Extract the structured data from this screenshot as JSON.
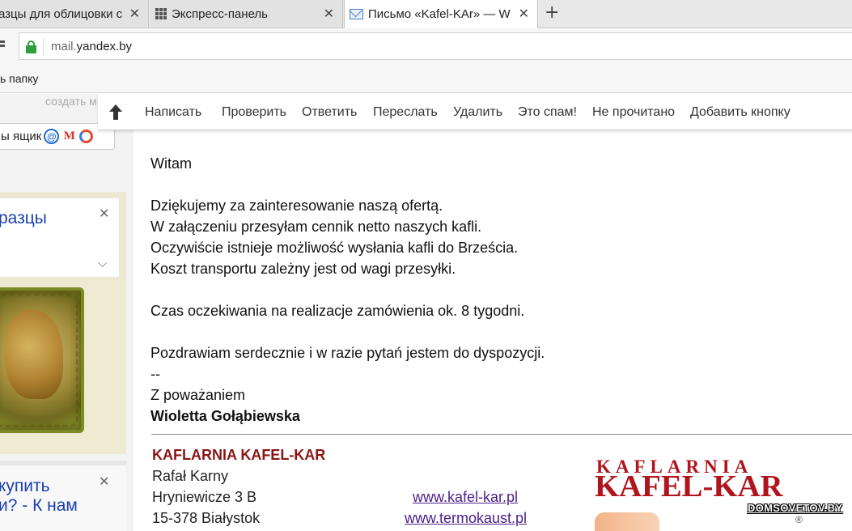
{
  "browser": {
    "tabs": [
      {
        "title": "азцы для облицовки с",
        "close": "✕"
      },
      {
        "title": "Экспресс-панель",
        "close": "✕"
      },
      {
        "title": "Письмо «Kafel-KAr» — Wi",
        "close": "✕"
      }
    ],
    "new_tab": "+",
    "url_prefix": "mail.",
    "url_domain": "yandex.by",
    "bookmark": "ь папку"
  },
  "sidebar": {
    "create_link": "создать м",
    "mailbox_label": "ы ящик",
    "services": {
      "at": "@",
      "gmail": "M",
      "other": ""
    },
    "ad1": {
      "title": "разцы",
      "close": "✕",
      "chevron": "⌵"
    },
    "ad2": {
      "line1": "купить",
      "line2": "и? - К нам",
      "close": "✕"
    }
  },
  "toolbar": {
    "actions": [
      "Написать",
      "Проверить",
      "Ответить",
      "Переслать",
      "Удалить",
      "Это спам!",
      "Не прочитано",
      "Добавить кнопку"
    ]
  },
  "message": {
    "greeting": "Witam",
    "body": [
      "Dziękujemy za zainteresowanie naszą ofertą.",
      "W załączeniu przesyłam cennik netto naszych kafli.",
      "Oczywiście istnieje możliwość wysłania kafli do Brześcia.",
      "Koszt transportu zależny jest od wagi przesyłki."
    ],
    "wait": "Czas oczekiwania na realizacje zamówienia ok. 8 tygodni.",
    "closing": "Pozdrawiam serdecznie i w razie pytań jestem do dyspozycji.",
    "dashes": "--",
    "regards": "Z poważaniem",
    "sender": "Wioletta Gołąbiewska"
  },
  "signature": {
    "company": "KAFLARNIA KAFEL-KAR",
    "person": "Rafał Karny",
    "street": "Hryniewicze 3 B",
    "city": "15-378 Białystok",
    "link1": "www.kafel-kar.pl",
    "link2": "www.termokaust.pl",
    "logo_top": "KAFLARNIA",
    "logo_main": "KAFEL-KAR",
    "logo_reg": "®"
  },
  "watermark": "DOMSOVETOV.BY",
  "colors": {
    "accent_link": "#1a3fb0",
    "company_red": "#8b1414",
    "lock_green": "#2e9e3e"
  }
}
